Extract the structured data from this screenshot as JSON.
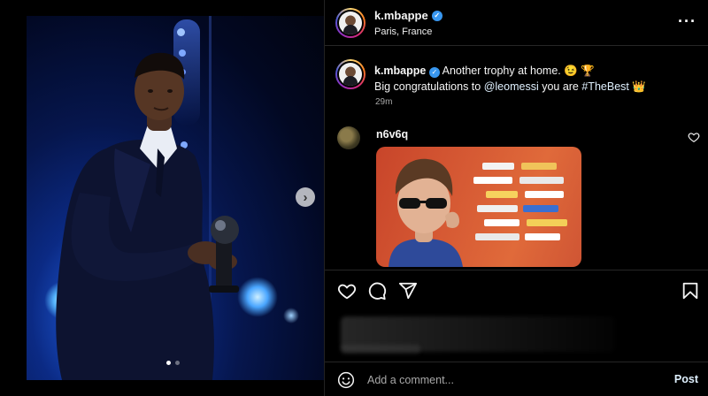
{
  "post": {
    "username": "k.mbappe",
    "location": "Paris, France",
    "carousel": {
      "slides": 2,
      "active_slide": 1
    }
  },
  "caption": {
    "username": "k.mbappe",
    "text_part1": "Another trophy at home. 😉 🏆",
    "text_part2": "Big congratulations to ",
    "mention": "@leomessi",
    "text_part3": " you are ",
    "hashtag": "#TheBest",
    "text_part4": " 👑",
    "time": "29m"
  },
  "comment": {
    "username": "n6v6q"
  },
  "comment_bar": {
    "placeholder": "Add a comment...",
    "post_label": "Post"
  },
  "icons": {
    "more": "more-icon",
    "like": "heart-icon",
    "comment": "comment-icon",
    "share": "share-icon",
    "save": "bookmark-icon",
    "emoji": "emoji-icon",
    "next": "chevron-right-icon"
  },
  "colors": {
    "verified": "#3897f0",
    "link": "#e0f1ff",
    "muted": "#a8a8a8"
  }
}
